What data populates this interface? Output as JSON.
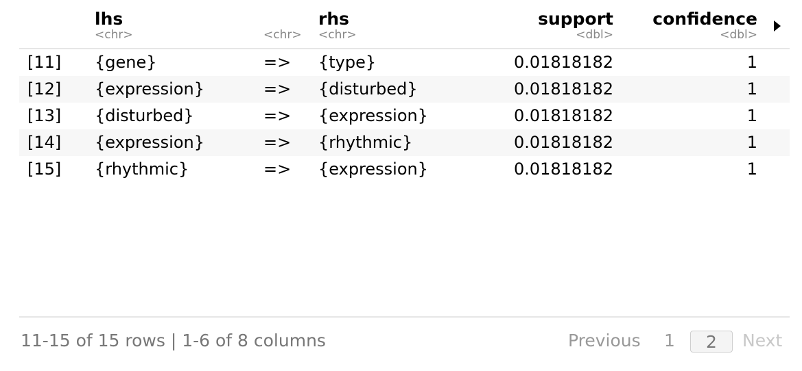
{
  "columns": [
    {
      "name": "lhs",
      "type": "<chr>"
    },
    {
      "name": "",
      "type": "<chr>"
    },
    {
      "name": "rhs",
      "type": "<chr>"
    },
    {
      "name": "support",
      "type": "<dbl>"
    },
    {
      "name": "confidence",
      "type": "<dbl>"
    }
  ],
  "rows": [
    {
      "index": "[11]",
      "lhs": "{gene}",
      "arrow": "=>",
      "rhs": "{type}",
      "support": "0.01818182",
      "confidence": "1"
    },
    {
      "index": "[12]",
      "lhs": "{expression}",
      "arrow": "=>",
      "rhs": "{disturbed}",
      "support": "0.01818182",
      "confidence": "1"
    },
    {
      "index": "[13]",
      "lhs": "{disturbed}",
      "arrow": "=>",
      "rhs": "{expression}",
      "support": "0.01818182",
      "confidence": "1"
    },
    {
      "index": "[14]",
      "lhs": "{expression}",
      "arrow": "=>",
      "rhs": "{rhythmic}",
      "support": "0.01818182",
      "confidence": "1"
    },
    {
      "index": "[15]",
      "lhs": "{rhythmic}",
      "arrow": "=>",
      "rhs": "{expression}",
      "support": "0.01818182",
      "confidence": "1"
    }
  ],
  "footer": {
    "summary": "11-15 of 15 rows | 1-6 of 8 columns",
    "previous": "Previous",
    "page1": "1",
    "page2": "2",
    "next": "Next"
  },
  "icons": {
    "next_columns": "triangle-right-icon"
  }
}
